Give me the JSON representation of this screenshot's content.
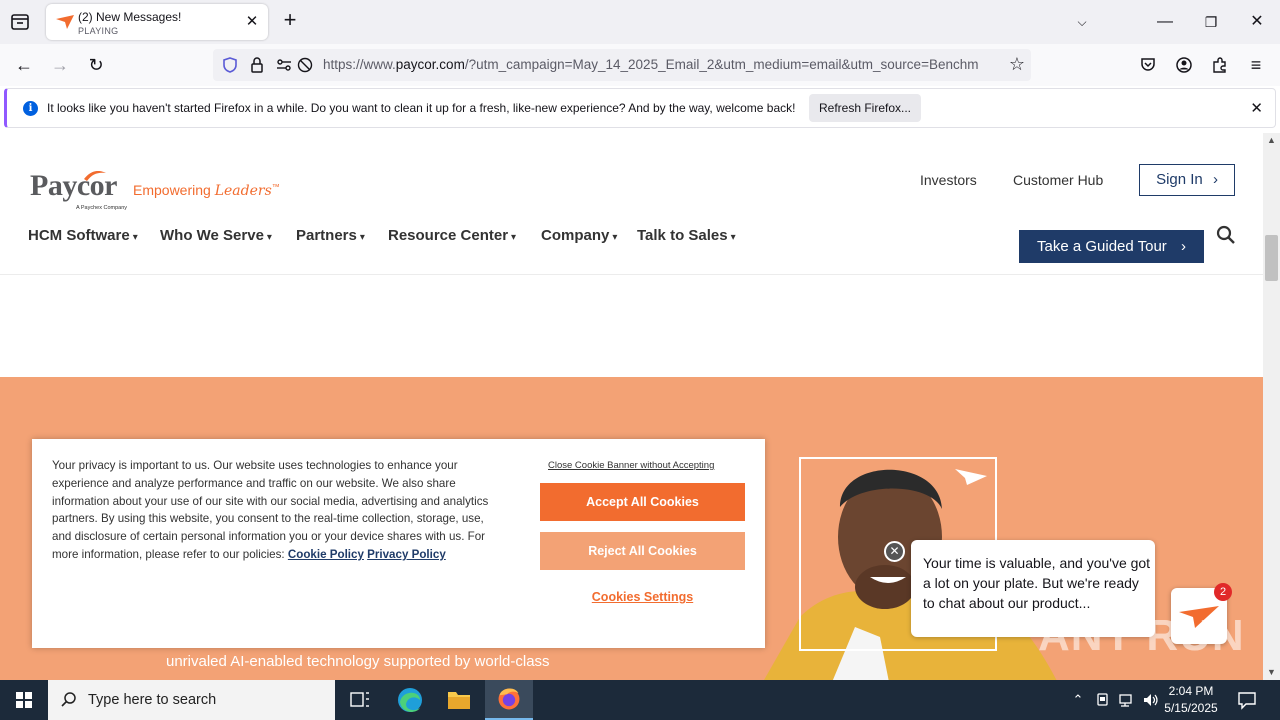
{
  "browser": {
    "tab": {
      "title": "(2) New Messages!",
      "status": "PLAYING"
    },
    "url": {
      "prefix": "https://www.",
      "host": "paycor.com",
      "rest": "/?utm_campaign=May_14_2025_Email_2&utm_medium=email&utm_source=Benchm"
    },
    "notice": {
      "message": "It looks like you haven't started Firefox in a while. Do you want to clean it up for a fresh, like-new experience? And by the way, welcome back!",
      "refresh_label": "Refresh Firefox..."
    }
  },
  "site": {
    "logo": {
      "word": "Paycor",
      "sub": "A Paychex Company",
      "tagline_1": "Empowering ",
      "tagline_2": "Leaders",
      "tm": "™"
    },
    "top_links": {
      "investors": "Investors",
      "customer_hub": "Customer Hub",
      "sign_in": "Sign In"
    },
    "menu": [
      "HCM Software",
      "Who We Serve",
      "Partners",
      "Resource Center",
      "Company",
      "Talk to Sales"
    ],
    "tour_label": "Take a Guided Tour",
    "hero_text": "unrivaled AI-enabled technology supported by world-class"
  },
  "cookie": {
    "text": "Your privacy is important to us. Our website uses technologies to enhance your experience and analyze performance and traffic on our website. We also share information about your use of our site with our social media, advertising and analytics partners. By using this website, you consent to the real-time collection, storage, use, and disclosure of certain personal information you or your device shares with us. For more information, please refer to our policies:",
    "cookie_policy": "Cookie Policy",
    "privacy_policy": "Privacy Policy",
    "close_link": "Close Cookie Banner without Accepting",
    "accept": "Accept All Cookies",
    "reject": "Reject All Cookies",
    "settings": "Cookies Settings"
  },
  "chat": {
    "message": "Your time is valuable, and you've got a lot on your plate. But we're ready to chat about our product...",
    "badge": "2"
  },
  "watermark": "ANY RUN",
  "taskbar": {
    "search_placeholder": "Type here to search",
    "time": "2:04 PM",
    "date": "5/15/2025"
  },
  "colors": {
    "brand_orange": "#f26c2f",
    "brand_navy": "#1f3b68",
    "hero": "#f3a275"
  }
}
